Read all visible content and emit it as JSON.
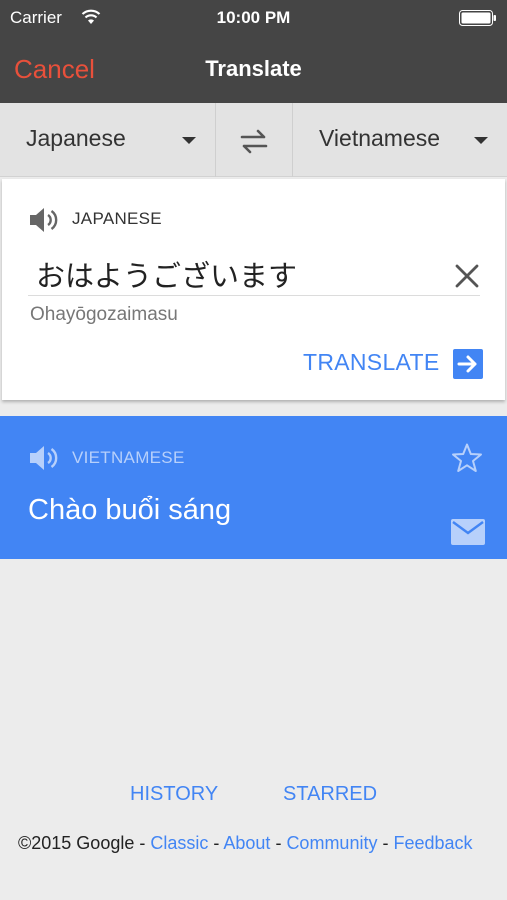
{
  "status_bar": {
    "carrier": "Carrier",
    "time": "10:00 PM",
    "wifi_icon": "wifi-icon",
    "battery_icon": "battery-icon"
  },
  "nav": {
    "cancel_label": "Cancel",
    "title": "Translate"
  },
  "language_bar": {
    "source_language": "Japanese",
    "target_language": "Vietnamese",
    "swap_icon": "swap-arrows-icon"
  },
  "input": {
    "language_label": "JAPANESE",
    "source_text": "おはようございます",
    "transliteration": "Ohayōgozaimasu",
    "translate_label": "TRANSLATE",
    "speaker_icon": "speaker-icon",
    "clear_icon": "close-icon",
    "translate_icon": "arrow-right-icon"
  },
  "result": {
    "language_label": "VIETNAMESE",
    "translated_text": "Chào buổi sáng",
    "speaker_icon": "speaker-icon",
    "star_icon": "star-outline-icon",
    "mail_icon": "mail-icon"
  },
  "links": {
    "history": "HISTORY",
    "starred": "STARRED"
  },
  "footer": {
    "copyright": "©2015 Google",
    "separator": " - ",
    "classic": "Classic",
    "about": "About",
    "community": "Community",
    "feedback": "Feedback"
  },
  "colors": {
    "header_bg": "#454545",
    "cancel": "#e8503b",
    "accent_blue": "#4285f4",
    "page_bg": "#ececec"
  }
}
